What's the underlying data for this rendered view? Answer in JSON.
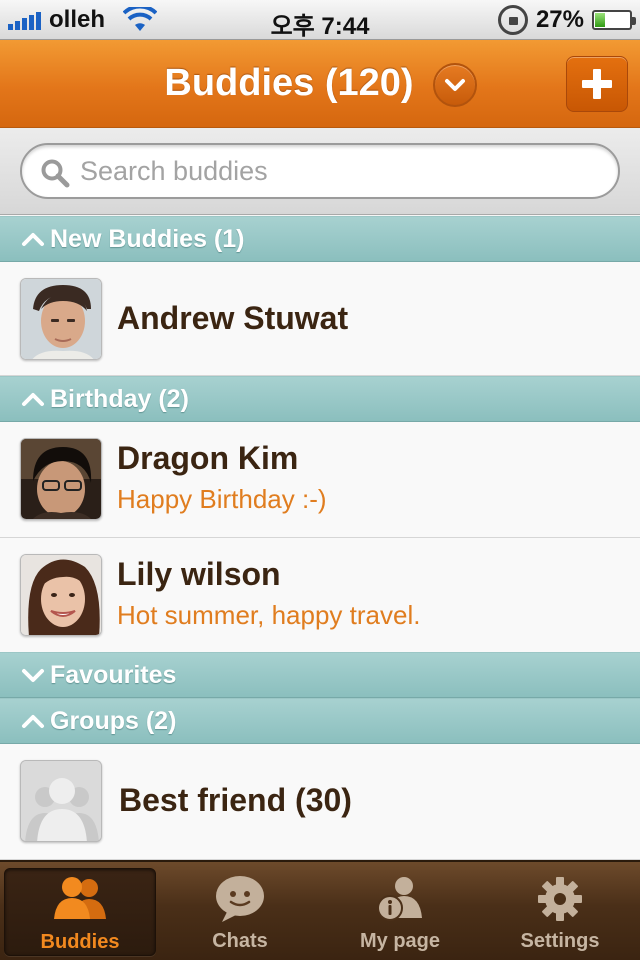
{
  "status_bar": {
    "carrier": "olleh",
    "time": "오후 7:44",
    "battery": "27%",
    "battery_level": 0.27
  },
  "nav": {
    "title": "Buddies (120)",
    "dropdown_icon": "chevron-down-icon",
    "add_icon": "plus-icon"
  },
  "search": {
    "placeholder": "Search buddies",
    "value": ""
  },
  "sections": {
    "new_buddies": "New Buddies (1)",
    "birthday": "Birthday (2)",
    "favourites": "Favourites",
    "groups": "Groups (2)"
  },
  "rows": {
    "andrew": {
      "name": "Andrew Stuwat"
    },
    "dragon": {
      "name": "Dragon Kim",
      "status": "Happy Birthday :-)"
    },
    "lily": {
      "name": "Lily wilson",
      "status": "Hot summer, happy travel."
    },
    "best_friend": {
      "name": "Best friend (30)"
    }
  },
  "tabs": {
    "buddies": "Buddies",
    "chats": "Chats",
    "mypage": "My page",
    "settings": "Settings"
  },
  "colors": {
    "accent_orange": "#e3761a",
    "section_teal": "#9ac8c7",
    "name_brown": "#3b2512",
    "status_orange": "#e07d1f",
    "tabbar_brown": "#4a2f18"
  }
}
